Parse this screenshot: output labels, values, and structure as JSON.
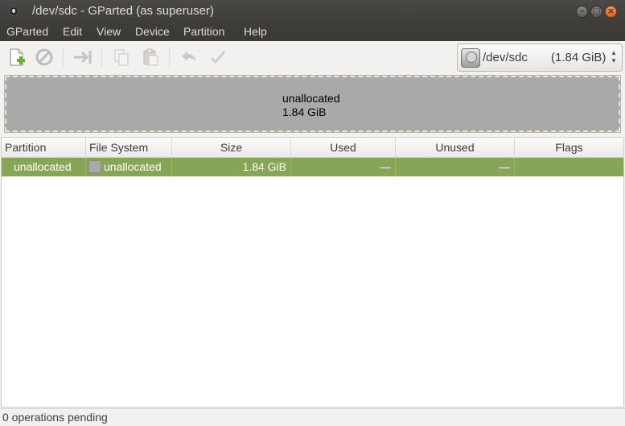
{
  "window": {
    "title": "/dev/sdc - GParted (as superuser)"
  },
  "menubar": {
    "items": [
      "GParted",
      "Edit",
      "View",
      "Device",
      "Partition",
      "Help"
    ]
  },
  "toolbar": {
    "buttons": [
      {
        "icon": "new-partition-icon",
        "enabled": true
      },
      {
        "icon": "delete-icon",
        "enabled": false
      },
      {
        "icon": "resize-move-icon",
        "enabled": false
      },
      {
        "icon": "copy-icon",
        "enabled": false
      },
      {
        "icon": "paste-icon",
        "enabled": false
      },
      {
        "icon": "undo-icon",
        "enabled": false
      },
      {
        "icon": "apply-icon",
        "enabled": false
      }
    ],
    "device": {
      "name": "/dev/sdc",
      "size": "(1.84 GiB)",
      "icon": "harddisk-icon"
    }
  },
  "diskmap": {
    "label": "unallocated",
    "size": "1.84 GiB"
  },
  "table": {
    "columns": [
      "Partition",
      "File System",
      "Size",
      "Used",
      "Unused",
      "Flags"
    ],
    "rows": [
      {
        "partition": "unallocated",
        "filesystem": "unallocated",
        "size": "1.84 GiB",
        "used": "—",
        "unused": "—",
        "flags": ""
      }
    ]
  },
  "status": {
    "text": "0 operations pending"
  },
  "colors": {
    "selected_row": "#87a556",
    "unallocated": "#a9a9a9",
    "titlebar": "#3e3d39"
  }
}
